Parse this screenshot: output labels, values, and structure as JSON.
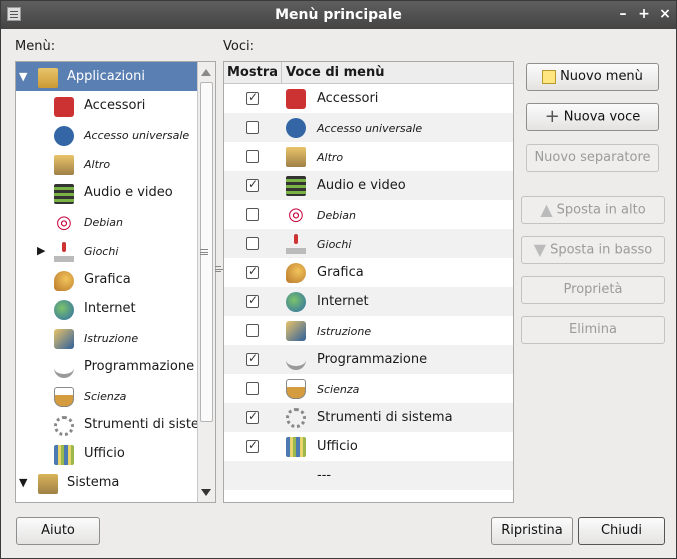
{
  "window": {
    "title": "Menù principale"
  },
  "labels": {
    "menu": "Menù:",
    "voci": "Voci:"
  },
  "tree": {
    "items": [
      {
        "label": "Applicazioni",
        "italic": false,
        "selected": true,
        "expander": "▼",
        "icon": "applications-icon"
      },
      {
        "label": "Accessori",
        "italic": false,
        "icon": "accessories-icon"
      },
      {
        "label": "Accesso universale",
        "italic": true,
        "icon": "accessibility-icon"
      },
      {
        "label": "Altro",
        "italic": true,
        "icon": "other-icon"
      },
      {
        "label": "Audio e video",
        "italic": false,
        "icon": "multimedia-icon"
      },
      {
        "label": "Debian",
        "italic": true,
        "icon": "debian-icon"
      },
      {
        "label": "Giochi",
        "italic": true,
        "expander": "▶",
        "icon": "games-icon"
      },
      {
        "label": "Grafica",
        "italic": false,
        "icon": "graphics-icon"
      },
      {
        "label": "Internet",
        "italic": false,
        "icon": "internet-icon"
      },
      {
        "label": "Istruzione",
        "italic": true,
        "icon": "education-icon"
      },
      {
        "label": "Programmazione",
        "italic": false,
        "icon": "programming-icon"
      },
      {
        "label": "Scienza",
        "italic": true,
        "icon": "science-icon"
      },
      {
        "label": "Strumenti di sistema",
        "italic": false,
        "icon": "system-tools-icon"
      },
      {
        "label": "Ufficio",
        "italic": false,
        "icon": "office-icon"
      },
      {
        "label": "Sistema",
        "italic": false,
        "expander": "▼",
        "icon": "system-icon"
      }
    ]
  },
  "table": {
    "headers": {
      "show": "Mostra",
      "item": "Voce di menù"
    },
    "rows": [
      {
        "checked": true,
        "label": "Accessori",
        "italic": false,
        "icon": "accessories-icon"
      },
      {
        "checked": false,
        "label": "Accesso universale",
        "italic": true,
        "icon": "accessibility-icon"
      },
      {
        "checked": false,
        "label": "Altro",
        "italic": true,
        "icon": "other-icon"
      },
      {
        "checked": true,
        "label": "Audio e video",
        "italic": false,
        "icon": "multimedia-icon"
      },
      {
        "checked": false,
        "label": "Debian",
        "italic": true,
        "icon": "debian-icon"
      },
      {
        "checked": false,
        "label": "Giochi",
        "italic": true,
        "icon": "games-icon"
      },
      {
        "checked": true,
        "label": "Grafica",
        "italic": false,
        "icon": "graphics-icon"
      },
      {
        "checked": true,
        "label": "Internet",
        "italic": false,
        "icon": "internet-icon"
      },
      {
        "checked": false,
        "label": "Istruzione",
        "italic": true,
        "icon": "education-icon"
      },
      {
        "checked": true,
        "label": "Programmazione",
        "italic": false,
        "icon": "programming-icon"
      },
      {
        "checked": false,
        "label": "Scienza",
        "italic": true,
        "icon": "science-icon"
      },
      {
        "checked": true,
        "label": "Strumenti di sistema",
        "italic": false,
        "icon": "system-tools-icon"
      },
      {
        "checked": true,
        "label": "Ufficio",
        "italic": false,
        "icon": "office-icon"
      },
      {
        "checked": null,
        "label": "---",
        "italic": false,
        "icon": null
      }
    ]
  },
  "buttons": {
    "new_menu": "Nuovo menù",
    "new_item": "Nuova voce",
    "new_separator": "Nuovo separatore",
    "move_up": "Sposta in alto",
    "move_down": "Sposta in basso",
    "properties": "Proprietà",
    "delete": "Elimina",
    "help": "Aiuto",
    "revert": "Ripristina",
    "close": "Chiudi"
  },
  "colors": {
    "selection": "#5a7fb2",
    "titlebar": "#4f4f4f"
  }
}
